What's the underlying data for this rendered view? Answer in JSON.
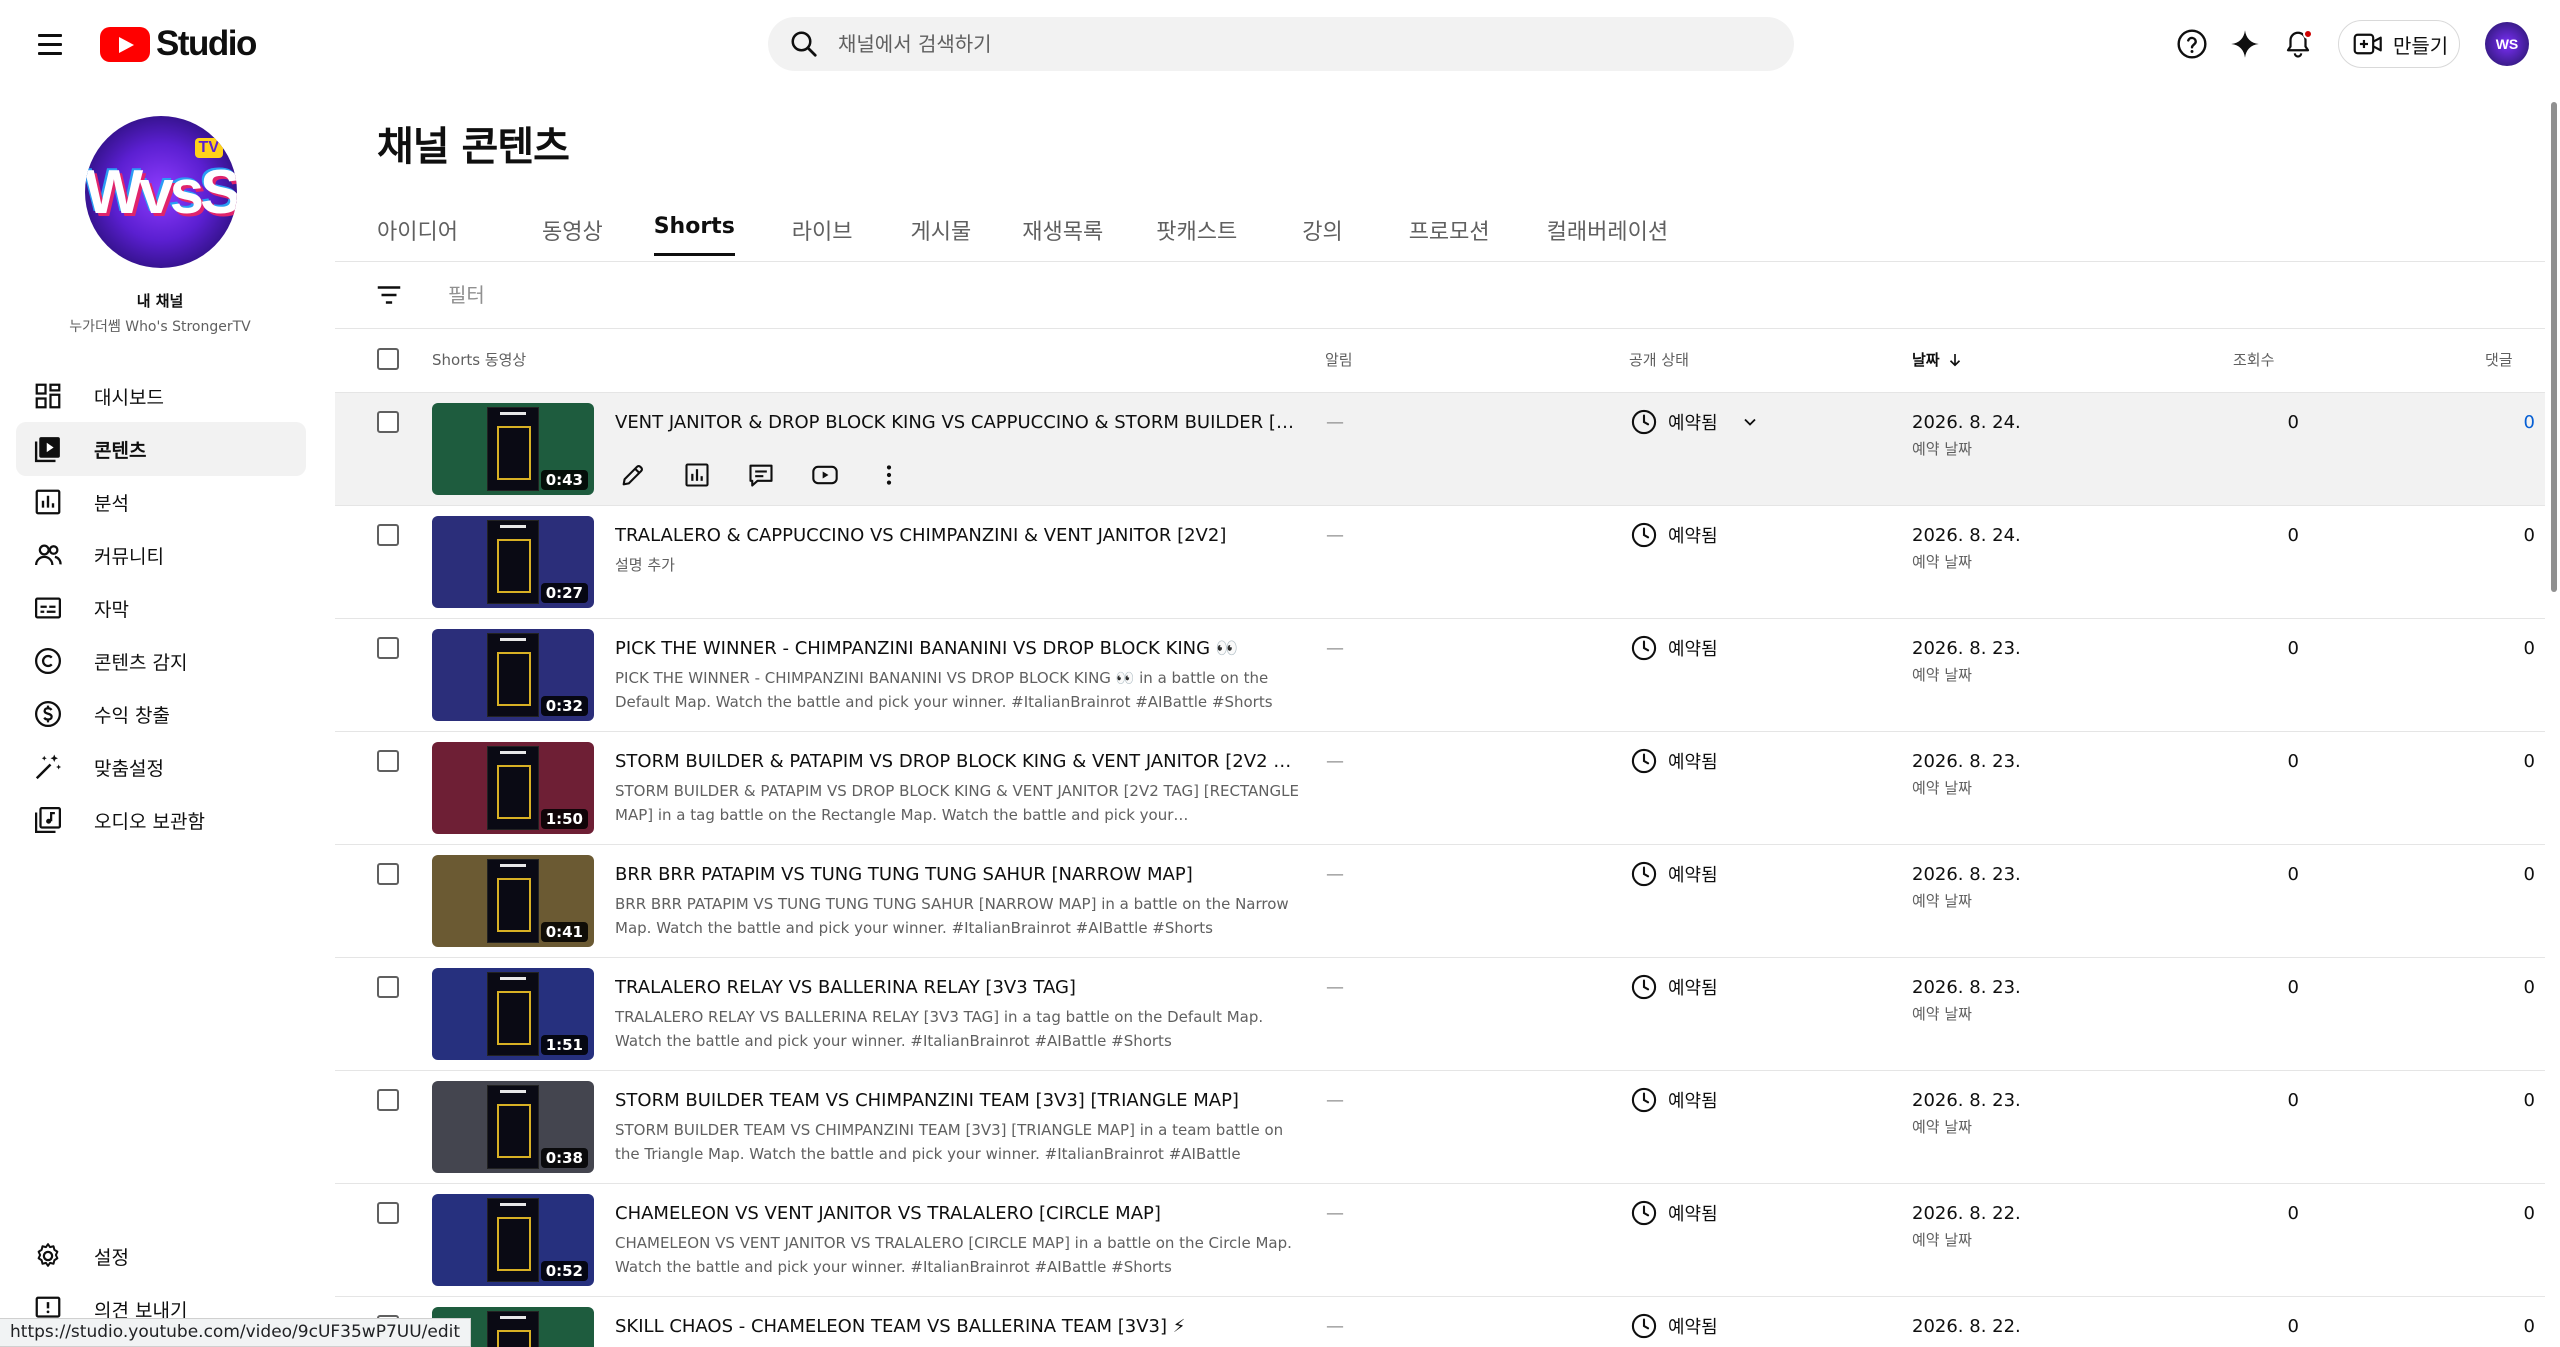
{
  "app": {
    "logo_text": "Studio"
  },
  "search": {
    "placeholder": "채널에서 검색하기"
  },
  "header": {
    "create_label": "만들기",
    "avatar_text": "WS"
  },
  "channel": {
    "my_channel_label": "내 채널",
    "name": "누가더쎔 Who's StrongerTV",
    "avatar_text": "WvsS",
    "avatar_badge": "TV"
  },
  "sidebar": {
    "items": [
      {
        "label": "대시보드",
        "icon": "dashboard-icon"
      },
      {
        "label": "콘텐츠",
        "icon": "content-icon",
        "active": true
      },
      {
        "label": "분석",
        "icon": "analytics-icon"
      },
      {
        "label": "커뮤니티",
        "icon": "community-icon"
      },
      {
        "label": "자막",
        "icon": "subtitles-icon"
      },
      {
        "label": "콘텐츠 감지",
        "icon": "copyright-icon"
      },
      {
        "label": "수익 창출",
        "icon": "monetization-icon"
      },
      {
        "label": "맞춤설정",
        "icon": "customization-icon"
      },
      {
        "label": "오디오 보관함",
        "icon": "audio-library-icon"
      }
    ],
    "bottom": [
      {
        "label": "설정",
        "icon": "settings-icon"
      },
      {
        "label": "의견 보내기",
        "icon": "feedback-icon"
      }
    ]
  },
  "page": {
    "title": "채널 콘텐츠",
    "tabs": [
      "아이디어",
      "동영상",
      "Shorts",
      "라이브",
      "게시물",
      "재생목록",
      "팟캐스트",
      "강의",
      "프로모션",
      "컬래버레이션"
    ],
    "active_tab": "Shorts",
    "filter_placeholder": "필터"
  },
  "table": {
    "headers": {
      "video": "Shorts 동영상",
      "alerts": "알림",
      "visibility": "공개 상태",
      "date": "날짜",
      "views": "조회수",
      "comments": "댓글"
    },
    "rows": [
      {
        "title": "VENT JANITOR & DROP BLOCK KING VS CAPPUCCINO & STORM BUILDER [2V…",
        "description": "",
        "duration": "0:43",
        "alert": "—",
        "visibility": "예약됨",
        "date": "2026. 8. 24.",
        "date_sub": "예약 날짜",
        "views": "0",
        "comments": "0",
        "thumb_color": "#1e5c3e",
        "hover": true
      },
      {
        "title": "TRALALERO & CAPPUCCINO VS CHIMPANZINI & VENT JANITOR [2V2]",
        "description": "설명 추가",
        "duration": "0:27",
        "alert": "—",
        "visibility": "예약됨",
        "date": "2026. 8. 24.",
        "date_sub": "예약 날짜",
        "views": "0",
        "comments": "0",
        "thumb_color": "#2b2e7a"
      },
      {
        "title": "PICK THE WINNER - CHIMPANZINI BANANINI VS DROP BLOCK KING 👀",
        "description": "PICK THE WINNER - CHIMPANZINI BANANINI VS DROP BLOCK KING 👀 in a battle on the Default Map. Watch the battle and pick your winner. #ItalianBrainrot #AIBattle #Shorts",
        "duration": "0:32",
        "alert": "—",
        "visibility": "예약됨",
        "date": "2026. 8. 23.",
        "date_sub": "예약 날짜",
        "views": "0",
        "comments": "0",
        "thumb_color": "#2b2e7a"
      },
      {
        "title": "STORM BUILDER & PATAPIM VS DROP BLOCK KING & VENT JANITOR [2V2 TA…",
        "description": "STORM BUILDER & PATAPIM VS DROP BLOCK KING & VENT JANITOR [2V2 TAG] [RECTANGLE MAP] in a tag battle on the Rectangle Map. Watch the battle and pick your…",
        "duration": "1:50",
        "alert": "—",
        "visibility": "예약됨",
        "date": "2026. 8. 23.",
        "date_sub": "예약 날짜",
        "views": "0",
        "comments": "0",
        "thumb_color": "#6e1f35"
      },
      {
        "title": "BRR BRR PATAPIM VS TUNG TUNG TUNG SAHUR [NARROW MAP]",
        "description": "BRR BRR PATAPIM VS TUNG TUNG TUNG SAHUR [NARROW MAP] in a battle on the Narrow Map. Watch the battle and pick your winner. #ItalianBrainrot #AIBattle #Shorts",
        "duration": "0:41",
        "alert": "—",
        "visibility": "예약됨",
        "date": "2026. 8. 23.",
        "date_sub": "예약 날짜",
        "views": "0",
        "comments": "0",
        "thumb_color": "#6b5a33"
      },
      {
        "title": "TRALALERO RELAY VS BALLERINA RELAY [3V3 TAG]",
        "description": "TRALALERO RELAY VS BALLERINA RELAY [3V3 TAG] in a tag battle on the Default Map. Watch the battle and pick your winner. #ItalianBrainrot #AIBattle #Shorts",
        "duration": "1:51",
        "alert": "—",
        "visibility": "예약됨",
        "date": "2026. 8. 23.",
        "date_sub": "예약 날짜",
        "views": "0",
        "comments": "0",
        "thumb_color": "#26307e"
      },
      {
        "title": "STORM BUILDER TEAM VS CHIMPANZINI TEAM [3V3] [TRIANGLE MAP]",
        "description": "STORM BUILDER TEAM VS CHIMPANZINI TEAM [3V3] [TRIANGLE MAP] in a team battle on the Triangle Map. Watch the battle and pick your winner. #ItalianBrainrot #AIBattle #Shorts",
        "duration": "0:38",
        "alert": "—",
        "visibility": "예약됨",
        "date": "2026. 8. 23.",
        "date_sub": "예약 날짜",
        "views": "0",
        "comments": "0",
        "thumb_color": "#44454f"
      },
      {
        "title": "CHAMELEON VS VENT JANITOR VS TRALALERO [CIRCLE MAP]",
        "description": "CHAMELEON VS VENT JANITOR VS TRALALERO [CIRCLE MAP] in a battle on the Circle Map. Watch the battle and pick your winner. #ItalianBrainrot #AIBattle #Shorts",
        "duration": "0:52",
        "alert": "—",
        "visibility": "예약됨",
        "date": "2026. 8. 22.",
        "date_sub": "예약 날짜",
        "views": "0",
        "comments": "0",
        "thumb_color": "#26307e"
      },
      {
        "title": "SKILL CHAOS - CHAMELEON TEAM VS BALLERINA TEAM [3V3] ⚡",
        "description": "",
        "duration": "",
        "alert": "—",
        "visibility": "예약됨",
        "date": "2026. 8. 22.",
        "date_sub": "",
        "views": "0",
        "comments": "0",
        "thumb_color": "#1e5c3e"
      }
    ]
  },
  "status_bar": {
    "url": "https://studio.youtube.com/video/9cUF35wP7UU/edit"
  }
}
